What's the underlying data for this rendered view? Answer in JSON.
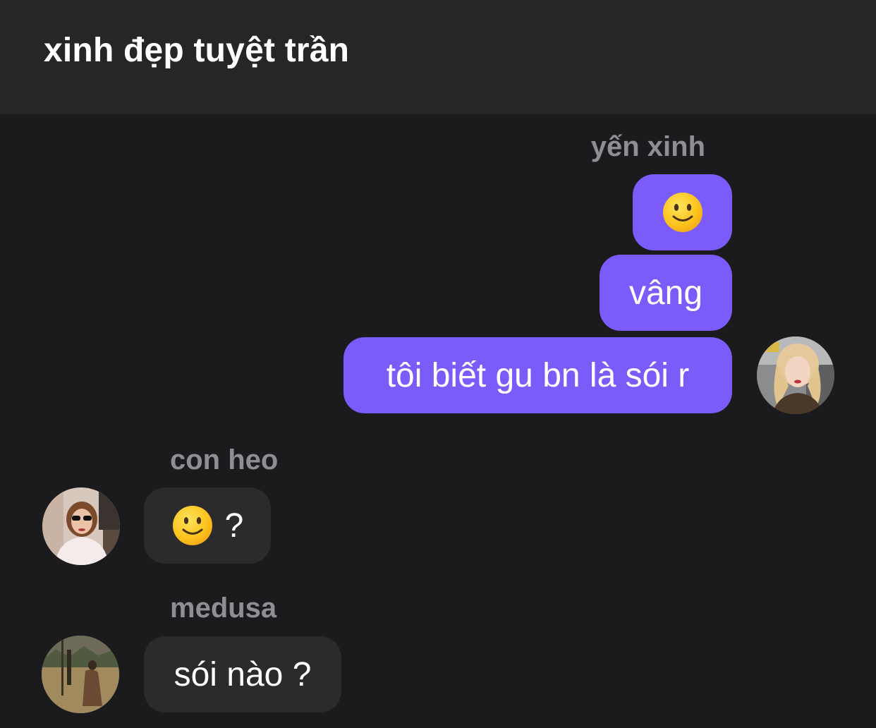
{
  "header": {
    "title": "xinh đẹp tuyệt trần"
  },
  "messages": {
    "group1": {
      "sender": "yến xinh",
      "bubble1_emoji": "slightly-smiling-face-emoji",
      "bubble2_text": "vâng",
      "bubble3_text": "tôi biết gu bn là sói r"
    },
    "group2": {
      "sender": "con heo",
      "bubble1_emoji": "slightly-smiling-face-emoji",
      "bubble1_text": "?"
    },
    "group3": {
      "sender": "medusa",
      "bubble1_text": "sói nào ?"
    }
  },
  "colors": {
    "background": "#1b1b1d",
    "header": "#262628",
    "outgoing_bubble": "#7b5cfa",
    "incoming_bubble": "#2b2b2e",
    "sender_name": "#8e8e93"
  }
}
